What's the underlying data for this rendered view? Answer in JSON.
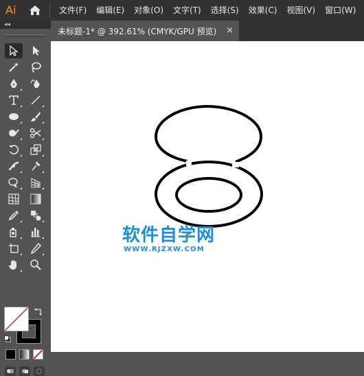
{
  "app": {
    "logo_text": "Ai",
    "logo_color": "#ff9a00"
  },
  "menu": {
    "items": [
      {
        "label": "文件(F)"
      },
      {
        "label": "编辑(E)"
      },
      {
        "label": "对象(O)"
      },
      {
        "label": "文字(T)"
      },
      {
        "label": "选择(S)"
      },
      {
        "label": "效果(C)"
      },
      {
        "label": "视图(V)"
      },
      {
        "label": "窗口(W)"
      }
    ]
  },
  "toolbar": {
    "collapse_label": "◂◂",
    "tools": [
      "selection-tool",
      "direct-selection-tool",
      "magic-wand-tool",
      "lasso-tool",
      "pen-tool",
      "curvature-tool",
      "type-tool",
      "line-segment-tool",
      "ellipse-tool",
      "paintbrush-tool",
      "shaper-tool",
      "scissors-tool",
      "rotate-tool",
      "scale-tool",
      "width-tool",
      "puppet-warp-tool",
      "shape-builder-tool",
      "perspective-grid-tool",
      "mesh-tool",
      "gradient-tool",
      "eyedropper-tool",
      "blend-tool",
      "symbol-sprayer-tool",
      "column-graph-tool",
      "artboard-tool",
      "slice-tool",
      "hand-tool",
      "zoom-tool"
    ],
    "active_tool": "selection-tool",
    "fill_color": "#ffffff",
    "stroke_color": "#000000"
  },
  "document": {
    "tab_title": "未标题-1* @ 392.61% (CMYK/GPU 预览)",
    "close_label": "×"
  },
  "watermark": {
    "title": "软件自学网",
    "url": "WWW.RJZXW.COM",
    "color": "#1a8fe0"
  }
}
